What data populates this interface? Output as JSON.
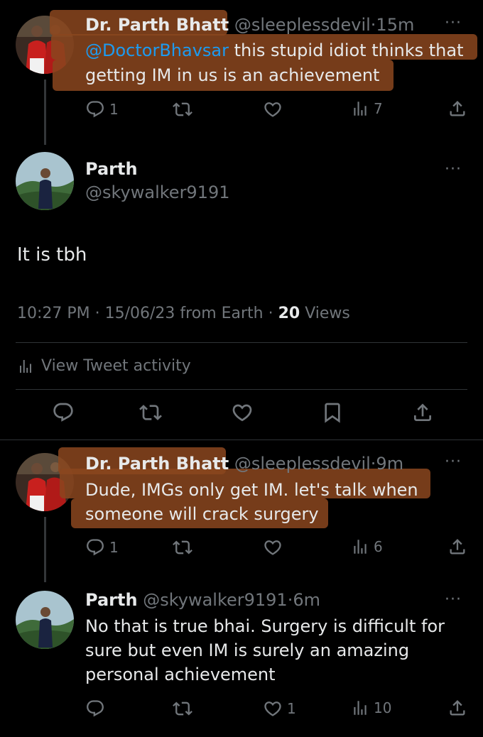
{
  "tweet1": {
    "name": "Dr. Parth Bhatt",
    "handle": "@sleeplessdevil",
    "dot": "·",
    "time": "15m",
    "mention": "@DoctorBhavsar",
    "line1_rest": " this stupid idiot thinks that",
    "line2": "getting IM in us is an achievement",
    "replies": "1",
    "views": "7"
  },
  "focus": {
    "name": "Parth",
    "handle": "@skywalker9191",
    "text": "It is tbh",
    "timestamp": "10:27 PM · 15/06/23 from Earth · ",
    "views_count": "20",
    "views_label": " Views",
    "activity": "View Tweet activity"
  },
  "tweet2": {
    "name": "Dr. Parth Bhatt",
    "handle": "@sleeplessdevil",
    "dot": "·",
    "time": "9m",
    "line1": "Dude, IMGs only get IM. let's talk when",
    "line2": "someone will crack surgery",
    "replies": "1",
    "views": "6"
  },
  "tweet3": {
    "name": "Parth",
    "handle": "@skywalker9191",
    "dot": "·",
    "time": "6m",
    "line1": "No that is true bhai. Surgery is difficult for",
    "line2": "sure but even IM is surely an amazing",
    "line3": "personal achievement",
    "likes": "1",
    "views": "10"
  },
  "more_label": "···",
  "colors": {
    "background": "#000000",
    "text": "#e7e9ea",
    "muted": "#71767b",
    "mention": "#1d9bf0",
    "highlight": "#8b471e"
  },
  "icons": [
    "reply-icon",
    "retweet-icon",
    "like-icon",
    "views-icon",
    "share-icon",
    "bookmark-icon"
  ]
}
